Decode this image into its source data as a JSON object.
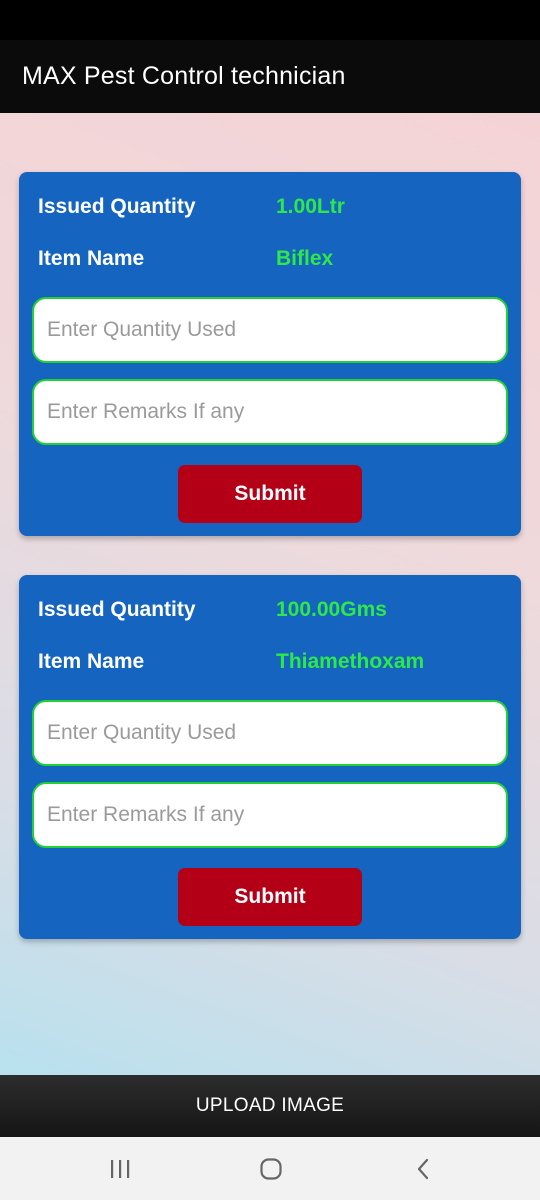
{
  "app": {
    "title": "MAX Pest Control technician"
  },
  "labels": {
    "issued_quantity": "Issued Quantity",
    "item_name": "Item Name",
    "quantity_placeholder": "Enter Quantity Used",
    "remarks_placeholder": "Enter Remarks If any",
    "submit": "Submit"
  },
  "items": [
    {
      "issued_quantity": "1.00Ltr",
      "item_name": "Biflex"
    },
    {
      "issued_quantity": "100.00Gms",
      "item_name": "Thiamethoxam"
    }
  ],
  "footer": {
    "upload_label": "UPLOAD IMAGE"
  },
  "colors": {
    "card": "#1565c0",
    "value_green": "#2ee84a",
    "submit_red": "#b30017",
    "field_border": "#22d133"
  },
  "icons": {
    "recent": "recent-apps-icon",
    "home": "home-icon",
    "back": "back-icon"
  }
}
